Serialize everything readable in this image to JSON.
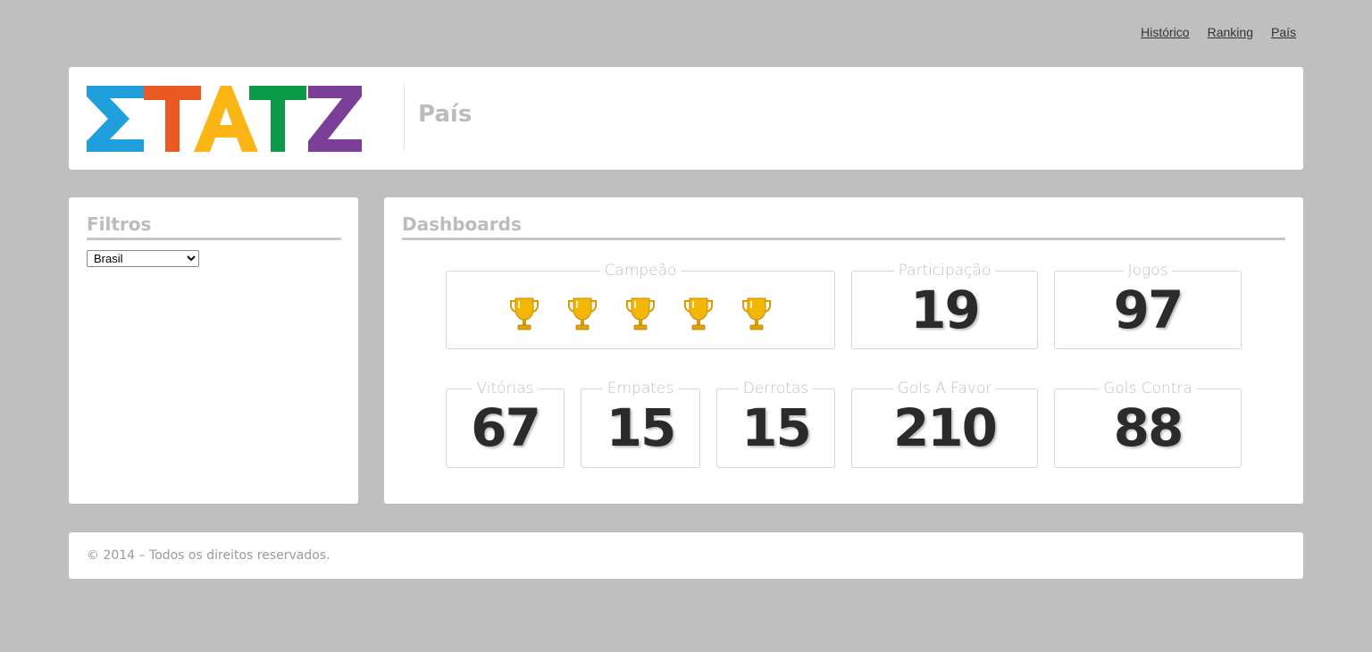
{
  "nav": {
    "historico": "Histórico",
    "ranking": "Ranking",
    "pais": "País"
  },
  "header": {
    "logo_text": "STATZ",
    "logo_colors": [
      "#1fa0dc",
      "#ec5a24",
      "#fbb616",
      "#0a9a4a",
      "#7c3f98"
    ],
    "title": "País"
  },
  "filters": {
    "title": "Filtros",
    "selected_country": "Brasil"
  },
  "dashboards": {
    "title": "Dashboards",
    "campeao": {
      "label": "Campeão",
      "trophy_count": 5,
      "icon": "trophy-icon"
    },
    "participacao": {
      "label": "Participação",
      "value": "19"
    },
    "jogos": {
      "label": "Jogos",
      "value": "97"
    },
    "vitorias": {
      "label": "Vitórias",
      "value": "67"
    },
    "empates": {
      "label": "Empates",
      "value": "15"
    },
    "derrotas": {
      "label": "Derrotas",
      "value": "15"
    },
    "gols_a_favor": {
      "label": "Gols A Favor",
      "value": "210"
    },
    "gols_contra": {
      "label": "Gols Contra",
      "value": "88"
    }
  },
  "footer": {
    "text": "© 2014 – Todos os direitos reservados."
  }
}
